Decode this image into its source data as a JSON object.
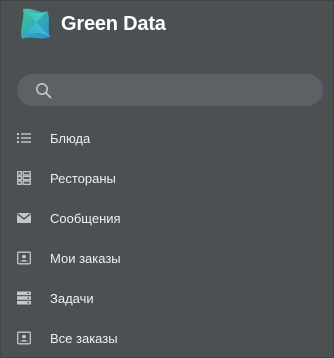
{
  "brand": {
    "name": "Green Data",
    "logo_colors": [
      "#3ec98a",
      "#2b8fd6",
      "#58e0c7"
    ]
  },
  "search": {
    "placeholder": "",
    "value": "",
    "icon": "search-icon"
  },
  "menu": {
    "items": [
      {
        "label": "Блюда",
        "icon": "list-icon"
      },
      {
        "label": "Рестораны",
        "icon": "grid-list-icon"
      },
      {
        "label": "Сообщения",
        "icon": "envelope-icon"
      },
      {
        "label": "Мои заказы",
        "icon": "id-card-icon"
      },
      {
        "label": "Задачи",
        "icon": "server-icon"
      },
      {
        "label": "Все заказы",
        "icon": "id-card-icon"
      }
    ]
  },
  "colors": {
    "sidebar_bg": "#4b5053",
    "search_bg": "#5b6165",
    "text": "#eef0f1",
    "icon": "#c3c7c9"
  }
}
